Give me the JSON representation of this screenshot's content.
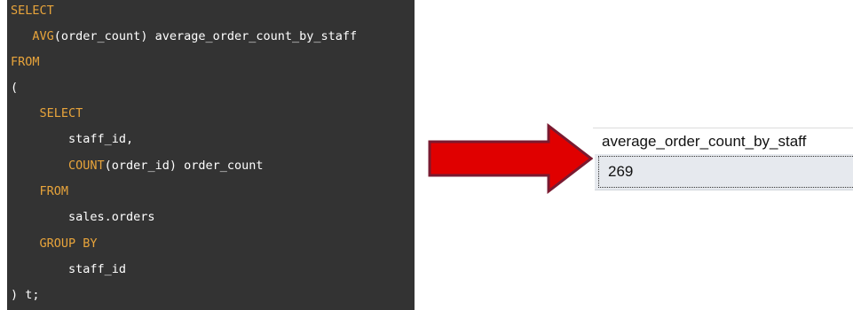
{
  "sql_editor": {
    "lines": [
      [
        {
          "t": "SELECT",
          "k": 1
        }
      ],
      [
        {
          "t": "   ",
          "k": 0
        },
        {
          "t": "AVG",
          "k": 1
        },
        {
          "t": "(order_count) average_order_count_by_staff",
          "k": 0
        }
      ],
      [
        {
          "t": "FROM",
          "k": 1
        }
      ],
      [
        {
          "t": "(",
          "k": 0
        }
      ],
      [
        {
          "t": "    ",
          "k": 0
        },
        {
          "t": "SELECT",
          "k": 1
        }
      ],
      [
        {
          "t": "        staff_id,",
          "k": 0
        }
      ],
      [
        {
          "t": "        ",
          "k": 0
        },
        {
          "t": "COUNT",
          "k": 1
        },
        {
          "t": "(order_id) order_count",
          "k": 0
        }
      ],
      [
        {
          "t": "    ",
          "k": 0
        },
        {
          "t": "FROM",
          "k": 1
        }
      ],
      [
        {
          "t": "        sales.orders",
          "k": 0
        }
      ],
      [
        {
          "t": "    ",
          "k": 0
        },
        {
          "t": "GROUP BY",
          "k": 1
        }
      ],
      [
        {
          "t": "        staff_id",
          "k": 0
        }
      ],
      [
        {
          "t": ") t;",
          "k": 0
        }
      ]
    ],
    "keyword_color": "#e8a43b",
    "text_color": "#ffffff",
    "background_color": "#333333"
  },
  "arrow": {
    "icon": "right-arrow-icon",
    "color": "#e00000",
    "outline_color": "#7a1a30"
  },
  "result_grid": {
    "column_header": "average_order_count_by_staff",
    "value": "269"
  }
}
